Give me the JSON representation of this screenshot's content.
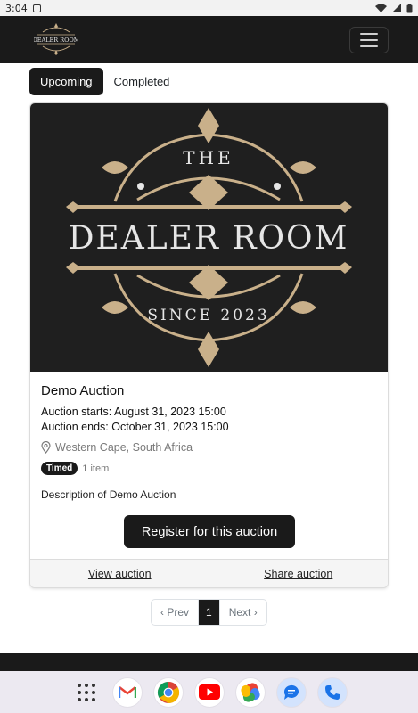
{
  "status_bar": {
    "time": "3:04"
  },
  "header": {
    "logo_text": "DEALER ROOM"
  },
  "tabs": [
    {
      "label": "Upcoming",
      "active": true
    },
    {
      "label": "Completed",
      "active": false
    }
  ],
  "auction": {
    "image_text_top": "THE",
    "image_text_main": "DEALER ROOM",
    "image_text_bottom": "SINCE 2023",
    "title": "Demo Auction",
    "starts": "Auction starts: August 31, 2023 15:00",
    "ends": "Auction ends: October 31, 2023 15:00",
    "location": "Western Cape, South Africa",
    "badge": "Timed",
    "items": "1 item",
    "description": "Description of Demo Auction",
    "register_label": "Register for this auction",
    "view_label": "View auction",
    "share_label": "Share auction"
  },
  "pagination": {
    "prev": "‹ Prev",
    "current": "1",
    "next": "Next ›"
  },
  "colors": {
    "dark": "#1a1a1a",
    "gold": "#c9b08a",
    "muted": "#7a7a7a"
  },
  "dock_apps": [
    "app-drawer-icon",
    "gmail-icon",
    "chrome-icon",
    "youtube-icon",
    "photos-icon",
    "messages-icon",
    "phone-icon"
  ]
}
